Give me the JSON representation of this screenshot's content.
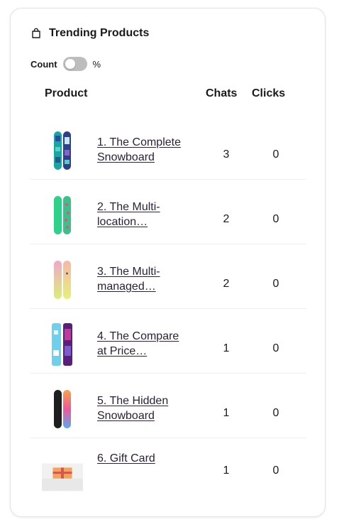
{
  "card": {
    "title": "Trending Products",
    "toggle": {
      "left_label": "Count",
      "right_label": "%",
      "on": false
    }
  },
  "table": {
    "headers": {
      "product": "Product",
      "chats": "Chats",
      "clicks": "Clicks"
    },
    "rows": [
      {
        "name": "1. The Complete Snowboard",
        "chats": "3",
        "clicks": "0",
        "icon": "snowboard-teal-icon"
      },
      {
        "name": "2. The Multi-location…",
        "chats": "2",
        "clicks": "0",
        "icon": "snowboard-green-icon"
      },
      {
        "name": "3. The Multi-managed…",
        "chats": "2",
        "clicks": "0",
        "icon": "snowboard-pastel-icon"
      },
      {
        "name": "4. The Compare at Price…",
        "chats": "1",
        "clicks": "0",
        "icon": "snowboard-blue-purple-icon"
      },
      {
        "name": "5. The Hidden Snowboard",
        "chats": "1",
        "clicks": "0",
        "icon": "snowboard-black-icon"
      },
      {
        "name": "6. Gift Card",
        "chats": "1",
        "clicks": "0",
        "icon": "gift-card-icon"
      }
    ]
  },
  "colors": {
    "link": "#2b2139",
    "toggle_off": "#bdbdbd",
    "border": "#e3e3e3"
  }
}
